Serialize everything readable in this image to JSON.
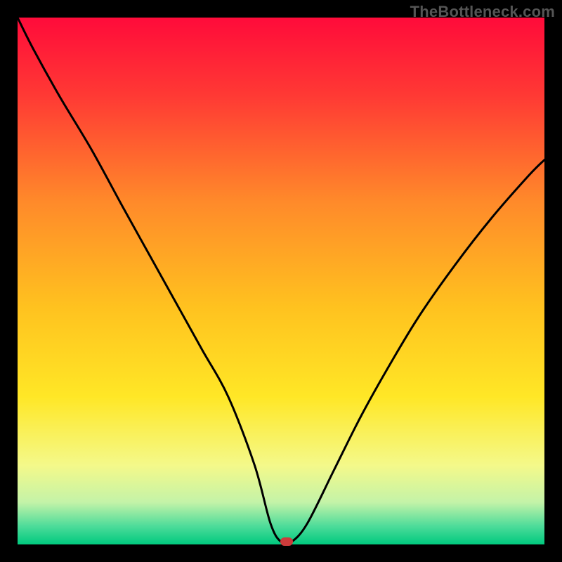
{
  "watermark": "TheBottleneck.com",
  "chart_data": {
    "type": "line",
    "title": "",
    "xlabel": "",
    "ylabel": "",
    "xlim": [
      0,
      100
    ],
    "ylim": [
      0,
      100
    ],
    "grid": false,
    "legend": false,
    "background_gradient": {
      "stops": [
        {
          "pos": 0.0,
          "color": "#ff0b3a"
        },
        {
          "pos": 0.15,
          "color": "#ff3a34"
        },
        {
          "pos": 0.35,
          "color": "#ff8a2a"
        },
        {
          "pos": 0.55,
          "color": "#ffc21f"
        },
        {
          "pos": 0.72,
          "color": "#ffe726"
        },
        {
          "pos": 0.85,
          "color": "#f4f98a"
        },
        {
          "pos": 0.92,
          "color": "#c4f3a8"
        },
        {
          "pos": 0.965,
          "color": "#4edc9a"
        },
        {
          "pos": 1.0,
          "color": "#00c97e"
        }
      ]
    },
    "series": [
      {
        "name": "bottleneck-curve",
        "color": "#000000",
        "x": [
          0,
          3,
          8,
          14,
          20,
          25,
          30,
          35,
          40,
          45,
          48,
          50,
          52,
          55,
          60,
          65,
          70,
          76,
          83,
          90,
          97,
          100
        ],
        "y": [
          100,
          94,
          85,
          75,
          64,
          55,
          46,
          37,
          28,
          15,
          4,
          0.5,
          0.5,
          4,
          14,
          24,
          33,
          43,
          53,
          62,
          70,
          73
        ]
      }
    ],
    "marker": {
      "x": 51,
      "y": 0.5,
      "color": "#cc3b3b"
    }
  }
}
